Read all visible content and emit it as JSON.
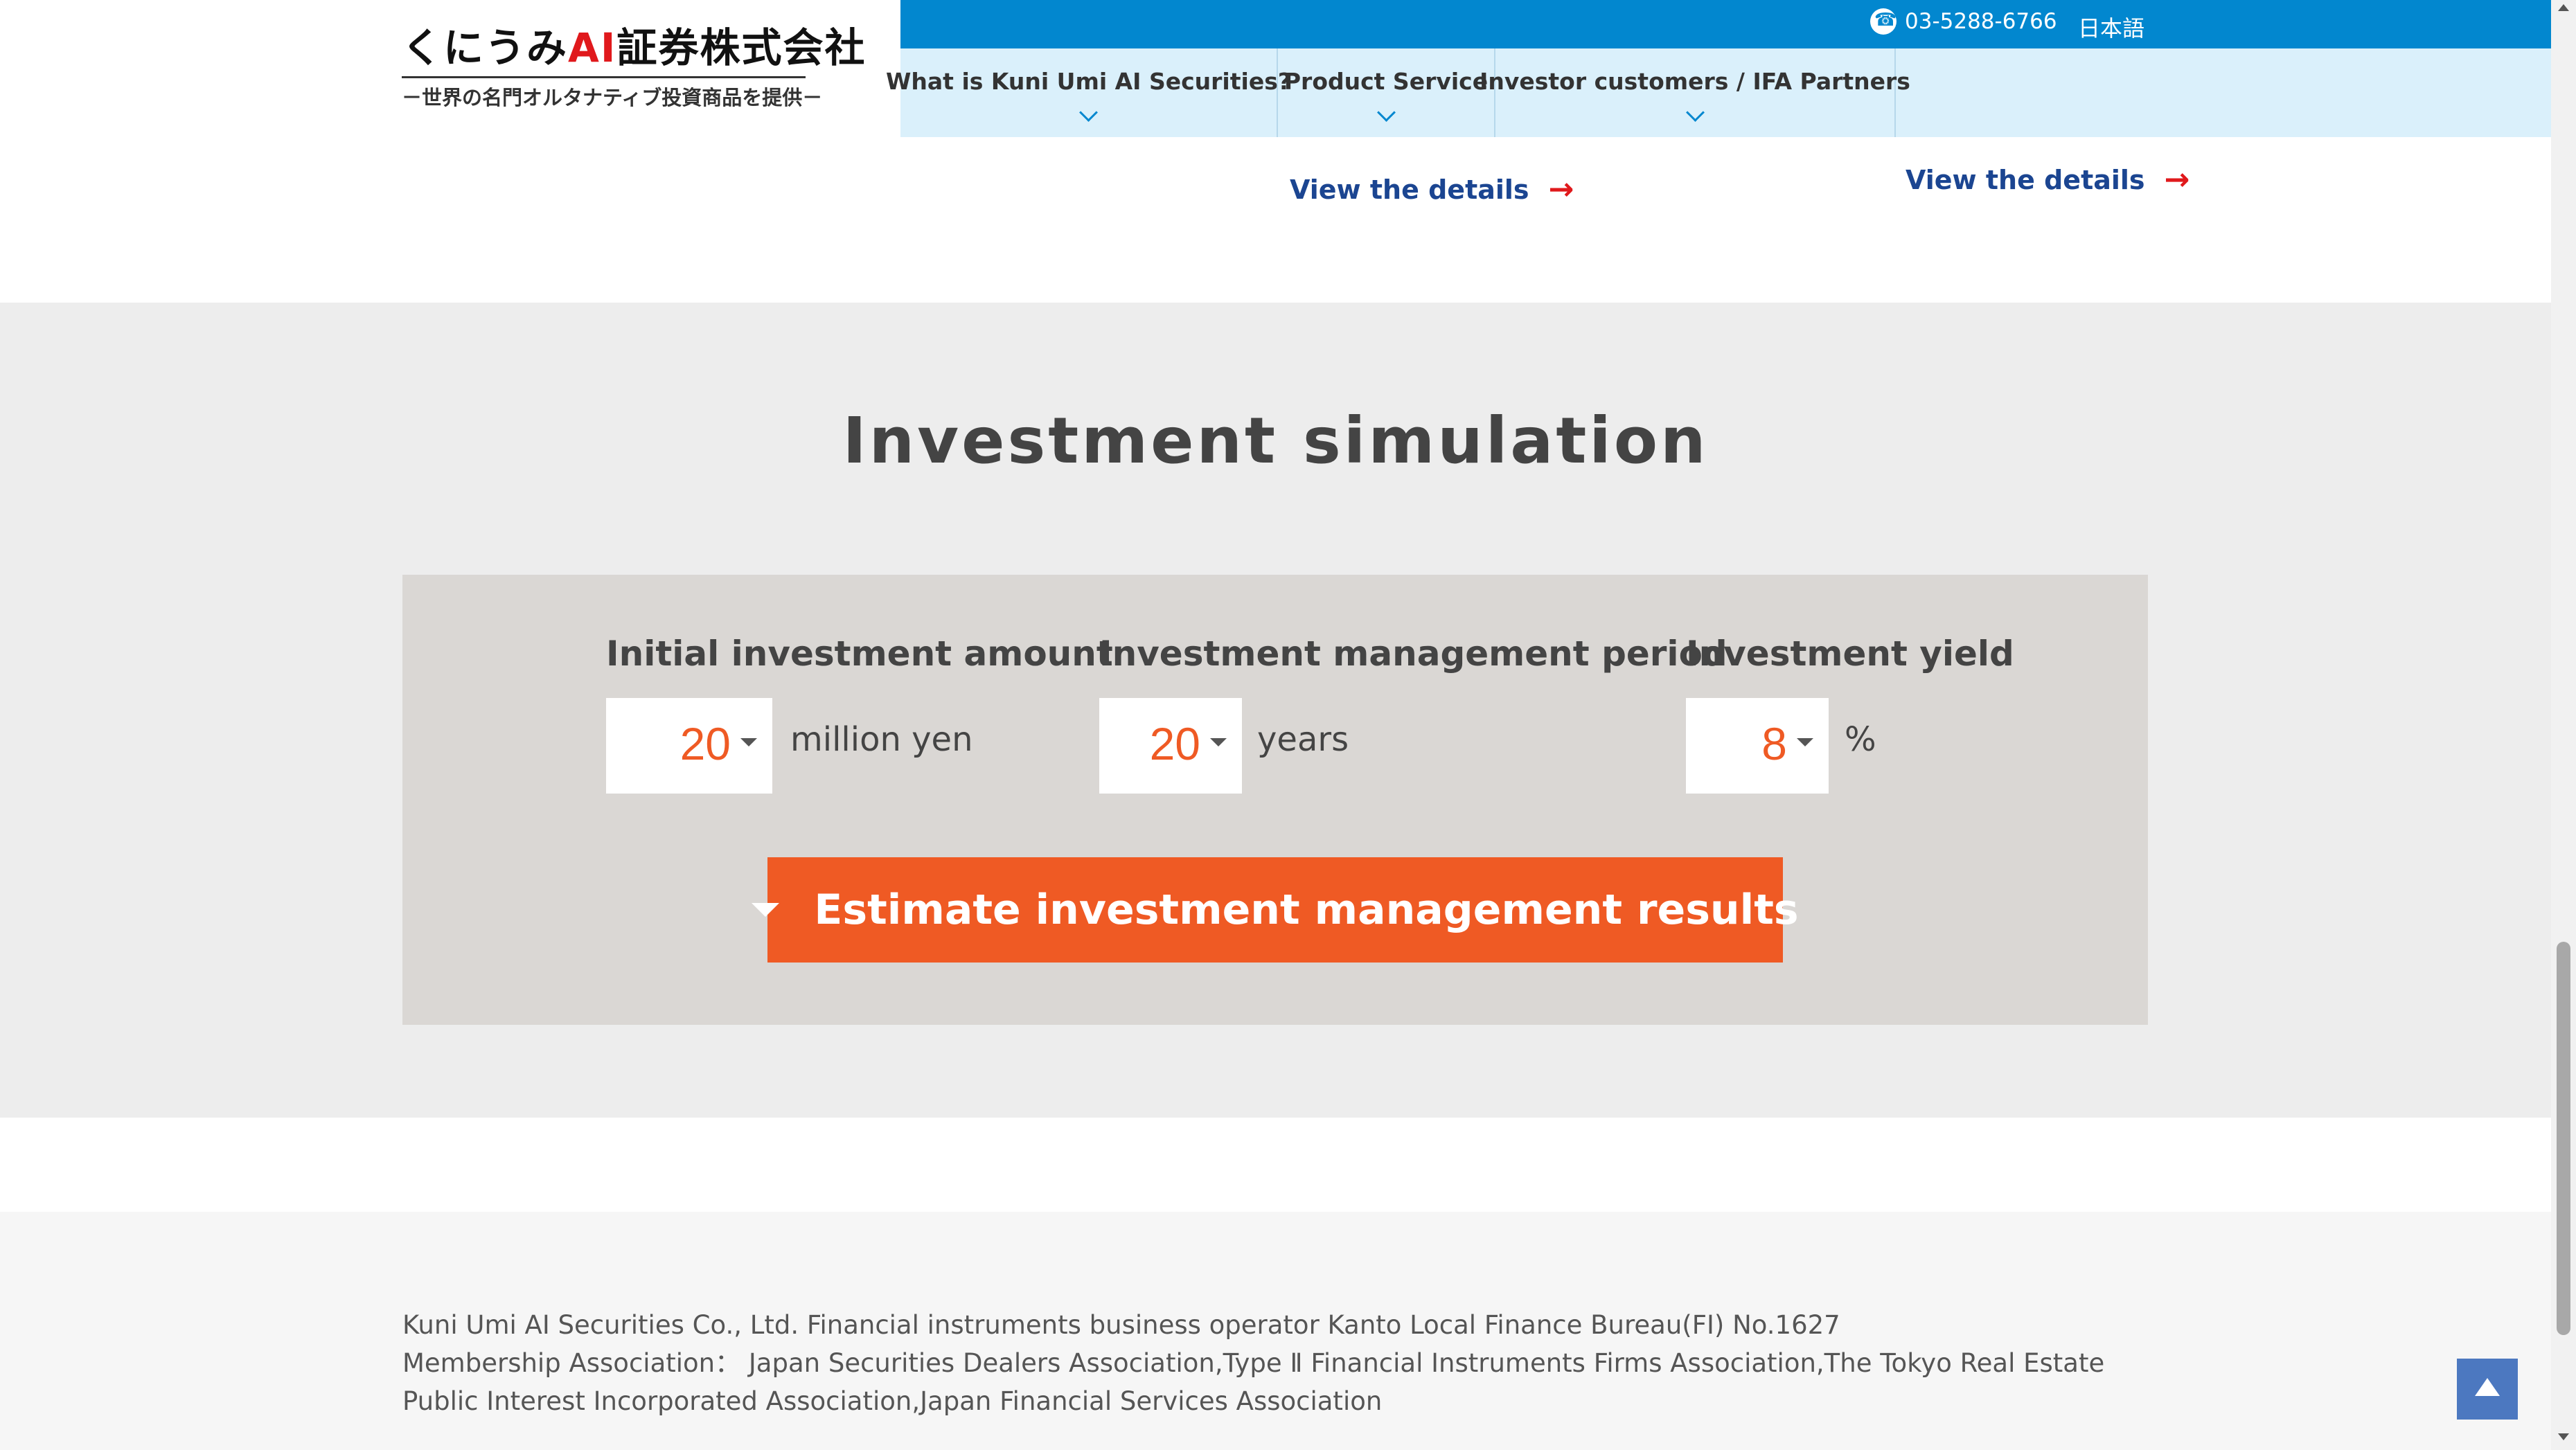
{
  "header": {
    "logo_prefix": "くにうみ",
    "logo_ai": "AI",
    "logo_suffix": "証券株式会社",
    "logo_tagline": "－世界の名門オルタナティブ投資商品を提供－",
    "phone": "03-5288-6766",
    "language": "日本語",
    "nav": [
      {
        "label": "What is Kuni Umi AI Securities?"
      },
      {
        "label": "Product Service"
      },
      {
        "label": "Investor customers / IFA Partners"
      }
    ]
  },
  "links": {
    "view_details_1": "View the details",
    "view_details_2": "View the details"
  },
  "simulation": {
    "title": "Investment simulation",
    "fields": {
      "amount": {
        "label": "Initial investment amount",
        "value": "20",
        "unit": "million yen"
      },
      "period": {
        "label": "Investment management period",
        "value": "20",
        "unit": "years"
      },
      "yield": {
        "label": "Investment yield",
        "value": "8",
        "unit": "%"
      }
    },
    "button_label": "Estimate investment management results"
  },
  "footer": {
    "line1": "Kuni Umi AI Securities Co., Ltd. Financial instruments business operator Kanto Local Finance Bureau(FI) No.1627",
    "line2": "Membership Association： Japan Securities Dealers Association,Type Ⅱ Financial Instruments Firms Association,The Tokyo Real Estate Public Interest Incorporated Association,Japan Financial Services Association"
  },
  "colors": {
    "topbar": "#0287cf",
    "nav_bg": "#daf0fb",
    "accent_orange": "#ef5a24",
    "link_blue": "#1b4591",
    "logo_red": "#e0191c"
  }
}
